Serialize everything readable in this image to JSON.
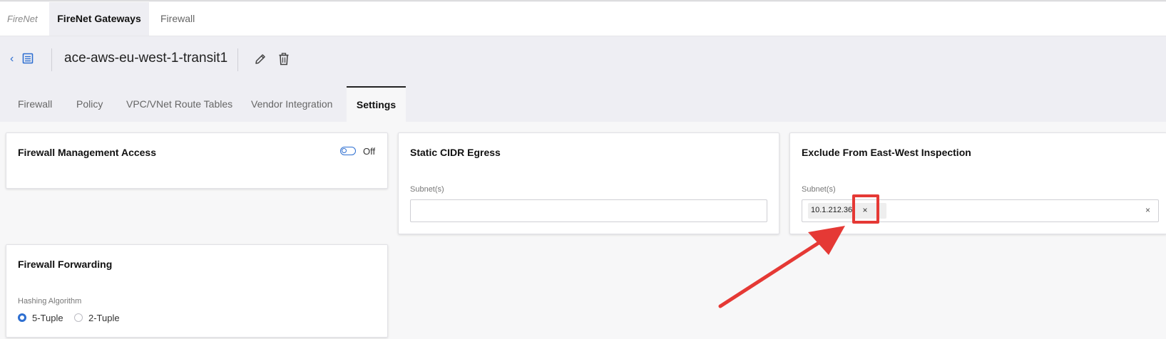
{
  "top_tabs": {
    "crumb": "FireNet",
    "active": "FireNet Gateways",
    "firewall": "Firewall"
  },
  "header": {
    "title": "ace-aws-eu-west-1-transit1",
    "back_glyph": "‹"
  },
  "sub_tabs": [
    "Firewall",
    "Policy",
    "VPC/VNet Route Tables",
    "Vendor Integration",
    "Settings"
  ],
  "active_sub_tab": "Settings",
  "cards": {
    "mgmt_access": {
      "title": "Firewall Management Access",
      "toggle_state": "Off",
      "toggle_on": false
    },
    "static_cidr": {
      "title": "Static CIDR Egress",
      "subnet_label": "Subnet(s)",
      "subnet_value": ""
    },
    "exclude_ew": {
      "title": "Exclude From East-West Inspection",
      "subnet_label": "Subnet(s)",
      "chip": "10.1.212.36",
      "chip_remove_glyph": "×",
      "clear_glyph": "×"
    },
    "forwarding": {
      "title": "Firewall Forwarding",
      "hashing_label": "Hashing Algorithm",
      "options": [
        "5-Tuple",
        "2-Tuple"
      ],
      "selected": "5-Tuple"
    }
  },
  "colors": {
    "accent": "#2e6fd1",
    "annotation": "#e53935",
    "header_bg": "#eeeef3",
    "page_bg": "#f7f7f8"
  },
  "icons": [
    "chevron-left-icon",
    "list-icon",
    "pencil-icon",
    "trash-icon",
    "toggle-icon",
    "close-icon"
  ]
}
